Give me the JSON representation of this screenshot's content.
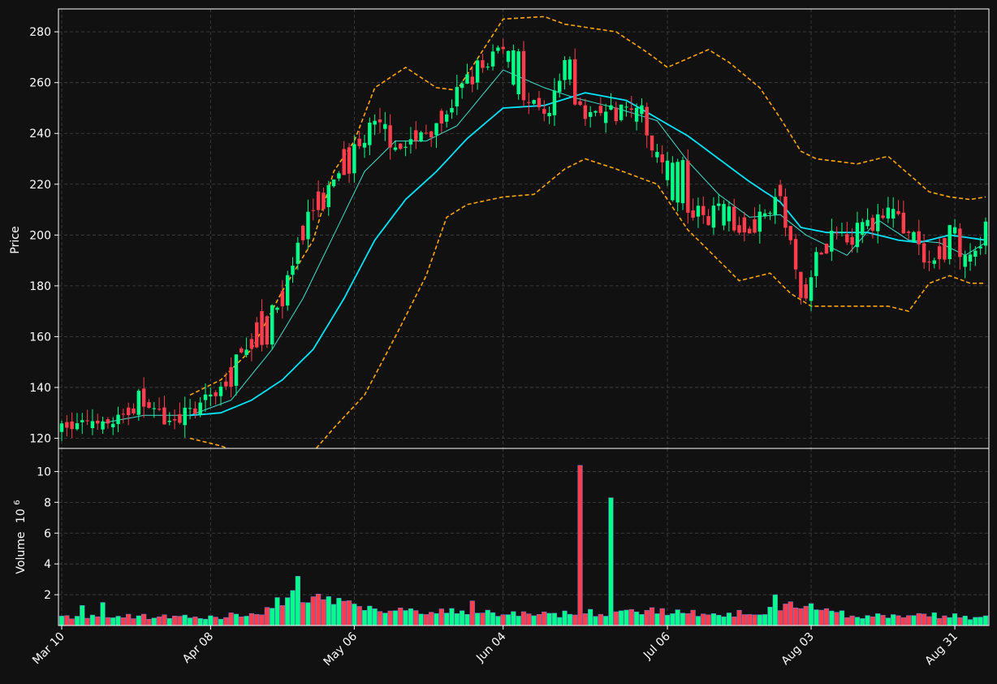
{
  "chart_data": {
    "type": "candlestick",
    "colors": {
      "background": "#111111",
      "up": "#00ff88",
      "down": "#ff3d4d",
      "ma_slow": "#00e5ff",
      "ma_fast": "#40e0d0",
      "bands": "#ffa500",
      "grid": "#444444",
      "frame": "#ffffff"
    },
    "price_panel": {
      "ylabel": "Price",
      "ylim": [
        116,
        289
      ],
      "yticks": [
        120,
        140,
        160,
        180,
        200,
        220,
        240,
        260,
        280
      ],
      "grid": true
    },
    "volume_panel": {
      "ylabel": "Volume",
      "ylabel_exponent": "10",
      "ylabel_power": "6",
      "ylim": [
        0,
        11.5
      ],
      "yticks": [
        2,
        4,
        6,
        8,
        10
      ],
      "grid": true
    },
    "x_axis": {
      "start_date": "2024-03-10",
      "end_date": "2024-09-06",
      "ticks": [
        {
          "date": "2024-03-10",
          "label": "Mar 10"
        },
        {
          "date": "2024-04-08",
          "label": "Apr 08"
        },
        {
          "date": "2024-05-06",
          "label": "May 06"
        },
        {
          "date": "2024-06-04",
          "label": "Jun 04"
        },
        {
          "date": "2024-07-06",
          "label": "Jul 06"
        },
        {
          "date": "2024-08-03",
          "label": "Aug 03"
        },
        {
          "date": "2024-08-31",
          "label": "Aug 31"
        }
      ]
    },
    "ohlc_anchors": [
      [
        "2024-03-10",
        125
      ],
      [
        "2024-03-20",
        125
      ],
      [
        "2024-03-25",
        136
      ],
      [
        "2024-03-30",
        128
      ],
      [
        "2024-04-05",
        131
      ],
      [
        "2024-04-10",
        140
      ],
      [
        "2024-04-18",
        168
      ],
      [
        "2024-04-22",
        176
      ],
      [
        "2024-04-28",
        212
      ],
      [
        "2024-05-04",
        232
      ],
      [
        "2024-05-10",
        242
      ],
      [
        "2024-05-16",
        235
      ],
      [
        "2024-05-22",
        245
      ],
      [
        "2024-05-30",
        265
      ],
      [
        "2024-06-04",
        275
      ],
      [
        "2024-06-08",
        252
      ],
      [
        "2024-06-12",
        245
      ],
      [
        "2024-06-16",
        265
      ],
      [
        "2024-06-20",
        247
      ],
      [
        "2024-06-26",
        248
      ],
      [
        "2024-07-01",
        248
      ],
      [
        "2024-07-06",
        220
      ],
      [
        "2024-07-10",
        208
      ],
      [
        "2024-07-16",
        208
      ],
      [
        "2024-07-22",
        203
      ],
      [
        "2024-07-28",
        216
      ],
      [
        "2024-08-01",
        175
      ],
      [
        "2024-08-04",
        192
      ],
      [
        "2024-08-08",
        200
      ],
      [
        "2024-08-14",
        203
      ],
      [
        "2024-08-18",
        213
      ],
      [
        "2024-08-22",
        198
      ],
      [
        "2024-08-26",
        188
      ],
      [
        "2024-08-30",
        200
      ],
      [
        "2024-09-03",
        188
      ],
      [
        "2024-09-06",
        205
      ]
    ],
    "ma_slow_anchors": [
      [
        "2024-04-04",
        129
      ],
      [
        "2024-04-10",
        130
      ],
      [
        "2024-04-16",
        135
      ],
      [
        "2024-04-22",
        143
      ],
      [
        "2024-04-28",
        155
      ],
      [
        "2024-05-04",
        175
      ],
      [
        "2024-05-10",
        198
      ],
      [
        "2024-05-16",
        214
      ],
      [
        "2024-05-22",
        225
      ],
      [
        "2024-05-28",
        238
      ],
      [
        "2024-06-04",
        250
      ],
      [
        "2024-06-12",
        251
      ],
      [
        "2024-06-20",
        256
      ],
      [
        "2024-06-28",
        253
      ],
      [
        "2024-07-04",
        246
      ],
      [
        "2024-07-10",
        239
      ],
      [
        "2024-07-16",
        230
      ],
      [
        "2024-07-22",
        221
      ],
      [
        "2024-07-28",
        213
      ],
      [
        "2024-08-01",
        203
      ],
      [
        "2024-08-06",
        201
      ],
      [
        "2024-08-14",
        201
      ],
      [
        "2024-08-20",
        198
      ],
      [
        "2024-08-24",
        197
      ],
      [
        "2024-08-30",
        200
      ],
      [
        "2024-09-06",
        198
      ]
    ],
    "ma_fast_anchors": [
      [
        "2024-03-18",
        126
      ],
      [
        "2024-03-26",
        129
      ],
      [
        "2024-04-04",
        129
      ],
      [
        "2024-04-12",
        135
      ],
      [
        "2024-04-20",
        155
      ],
      [
        "2024-04-26",
        175
      ],
      [
        "2024-05-02",
        200
      ],
      [
        "2024-05-08",
        225
      ],
      [
        "2024-05-14",
        237
      ],
      [
        "2024-05-20",
        237
      ],
      [
        "2024-05-26",
        243
      ],
      [
        "2024-06-04",
        265
      ],
      [
        "2024-06-12",
        258
      ],
      [
        "2024-06-18",
        254
      ],
      [
        "2024-06-26",
        250
      ],
      [
        "2024-07-04",
        245
      ],
      [
        "2024-07-10",
        229
      ],
      [
        "2024-07-16",
        216
      ],
      [
        "2024-07-22",
        207
      ],
      [
        "2024-07-28",
        208
      ],
      [
        "2024-08-02",
        200
      ],
      [
        "2024-08-10",
        192
      ],
      [
        "2024-08-16",
        206
      ],
      [
        "2024-08-22",
        198
      ],
      [
        "2024-08-28",
        197
      ],
      [
        "2024-09-02",
        192
      ],
      [
        "2024-09-06",
        197
      ]
    ],
    "upper_band_anchors": [
      [
        "2024-04-04",
        137
      ],
      [
        "2024-04-10",
        143
      ],
      [
        "2024-04-16",
        155
      ],
      [
        "2024-04-22",
        178
      ],
      [
        "2024-04-28",
        198
      ],
      [
        "2024-05-02",
        225
      ],
      [
        "2024-05-06",
        237
      ],
      [
        "2024-05-10",
        258
      ],
      [
        "2024-05-16",
        266
      ],
      [
        "2024-05-22",
        258
      ],
      [
        "2024-05-26",
        257
      ],
      [
        "2024-06-04",
        285
      ],
      [
        "2024-06-12",
        286
      ],
      [
        "2024-06-16",
        283
      ],
      [
        "2024-06-26",
        280
      ],
      [
        "2024-07-02",
        272
      ],
      [
        "2024-07-06",
        266
      ],
      [
        "2024-07-14",
        273
      ],
      [
        "2024-07-18",
        268
      ],
      [
        "2024-07-24",
        258
      ],
      [
        "2024-07-28",
        246
      ],
      [
        "2024-08-01",
        233
      ],
      [
        "2024-08-04",
        230
      ],
      [
        "2024-08-12",
        228
      ],
      [
        "2024-08-18",
        231
      ],
      [
        "2024-08-22",
        224
      ],
      [
        "2024-08-26",
        217
      ],
      [
        "2024-08-30",
        215
      ],
      [
        "2024-09-03",
        214
      ],
      [
        "2024-09-06",
        215
      ]
    ],
    "lower_band_anchors": [
      [
        "2024-04-04",
        120
      ],
      [
        "2024-04-10",
        117
      ],
      [
        "2024-04-14",
        114
      ],
      [
        "2024-04-26",
        110
      ],
      [
        "2024-05-02",
        124
      ],
      [
        "2024-05-08",
        137
      ],
      [
        "2024-05-14",
        160
      ],
      [
        "2024-05-20",
        184
      ],
      [
        "2024-05-24",
        207
      ],
      [
        "2024-05-28",
        212
      ],
      [
        "2024-06-04",
        215
      ],
      [
        "2024-06-10",
        216
      ],
      [
        "2024-06-16",
        226
      ],
      [
        "2024-06-20",
        230
      ],
      [
        "2024-06-26",
        226
      ],
      [
        "2024-07-04",
        220
      ],
      [
        "2024-07-10",
        202
      ],
      [
        "2024-07-16",
        190
      ],
      [
        "2024-07-20",
        182
      ],
      [
        "2024-07-26",
        185
      ],
      [
        "2024-07-30",
        177
      ],
      [
        "2024-08-03",
        172
      ],
      [
        "2024-08-12",
        172
      ],
      [
        "2024-08-18",
        172
      ],
      [
        "2024-08-22",
        170
      ],
      [
        "2024-08-26",
        181
      ],
      [
        "2024-08-30",
        184
      ],
      [
        "2024-09-03",
        181
      ],
      [
        "2024-09-06",
        181
      ]
    ],
    "volume_anchors": [
      [
        "2024-03-10",
        0.6
      ],
      [
        "2024-03-25",
        0.6
      ],
      [
        "2024-04-08",
        0.5
      ],
      [
        "2024-04-18",
        0.9
      ],
      [
        "2024-04-24",
        2.0
      ],
      [
        "2024-05-06",
        1.2
      ],
      [
        "2024-06-01",
        0.8
      ],
      [
        "2024-06-12",
        0.7
      ],
      [
        "2024-07-05",
        1.0
      ],
      [
        "2024-07-16",
        0.6
      ],
      [
        "2024-08-01",
        1.3
      ],
      [
        "2024-08-12",
        0.6
      ],
      [
        "2024-08-26",
        0.7
      ],
      [
        "2024-09-06",
        0.5
      ]
    ],
    "volume_spikes": [
      [
        "2024-03-14",
        1.3
      ],
      [
        "2024-03-18",
        1.5
      ],
      [
        "2024-04-22",
        1.3
      ],
      [
        "2024-04-25",
        3.2
      ],
      [
        "2024-04-26",
        1.5
      ],
      [
        "2024-05-06",
        1.4
      ],
      [
        "2024-05-29",
        1.6
      ],
      [
        "2024-06-01",
        1.0
      ],
      [
        "2024-06-19",
        10.4
      ],
      [
        "2024-06-25",
        8.3
      ],
      [
        "2024-07-26",
        1.2
      ],
      [
        "2024-07-27",
        2.0
      ],
      [
        "2024-07-29",
        1.4
      ],
      [
        "2024-08-01",
        1.1
      ],
      [
        "2024-08-05",
        1.0
      ]
    ]
  }
}
